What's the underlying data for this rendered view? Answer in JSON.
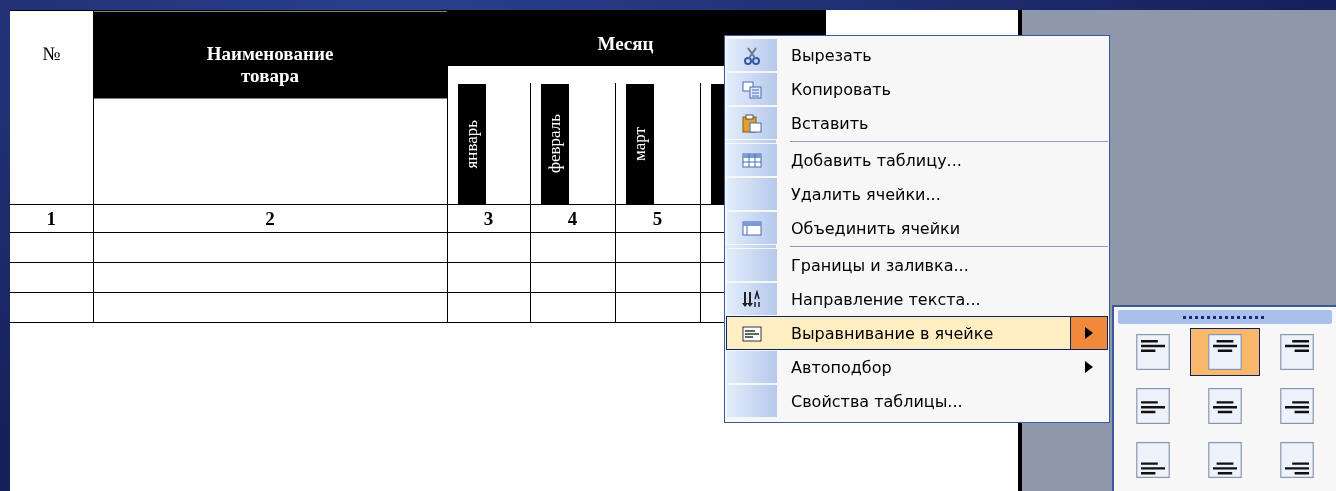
{
  "document": {
    "table": {
      "header": {
        "number": "№",
        "name": "Наименование товара",
        "month": "Месяц",
        "months": [
          "январь",
          "февраль",
          "март"
        ]
      },
      "column_numbers": [
        "1",
        "2",
        "3",
        "4",
        "5"
      ],
      "blank_rows": [
        {
          "kind": "blank"
        },
        {
          "kind": "blank"
        },
        {
          "kind": "blank"
        }
      ]
    }
  },
  "context_menu": {
    "items": [
      {
        "kind": "scissors",
        "label": "Вырезать",
        "has_submenu": false,
        "selected": false
      },
      {
        "kind": "copy",
        "label": "Копировать",
        "has_submenu": false,
        "selected": false
      },
      {
        "kind": "paste",
        "label": "Вставить",
        "has_submenu": false,
        "selected": false
      },
      {
        "kind": "separator"
      },
      {
        "kind": "table",
        "label": "Добавить таблицу...",
        "has_submenu": false,
        "selected": false
      },
      {
        "kind": "plain",
        "label": "Удалить ячейки...",
        "has_submenu": false,
        "selected": false
      },
      {
        "kind": "merge",
        "label": "Объединить ячейки",
        "has_submenu": false,
        "selected": false
      },
      {
        "kind": "separator"
      },
      {
        "kind": "plain",
        "label": "Границы и заливка...",
        "has_submenu": false,
        "selected": false
      },
      {
        "kind": "direction",
        "label": "Направление текста...",
        "has_submenu": false,
        "selected": false
      },
      {
        "kind": "align",
        "label": "Выравнивание в ячейке",
        "has_submenu": true,
        "selected": true
      },
      {
        "kind": "plain",
        "label": "Автоподбор",
        "has_submenu": true,
        "selected": false
      },
      {
        "kind": "plain",
        "label": "Свойства таблицы...",
        "has_submenu": false,
        "selected": false
      }
    ]
  },
  "alignment_palette": {
    "buttons": [
      {
        "kind": "top-left",
        "selected": false
      },
      {
        "kind": "top-center",
        "selected": true
      },
      {
        "kind": "top-right",
        "selected": false
      },
      {
        "kind": "middle-left",
        "selected": false
      },
      {
        "kind": "middle-center",
        "selected": false
      },
      {
        "kind": "middle-right",
        "selected": false
      },
      {
        "kind": "bottom-left",
        "selected": false
      },
      {
        "kind": "bottom-center",
        "selected": false
      },
      {
        "kind": "bottom-right",
        "selected": false
      }
    ]
  }
}
